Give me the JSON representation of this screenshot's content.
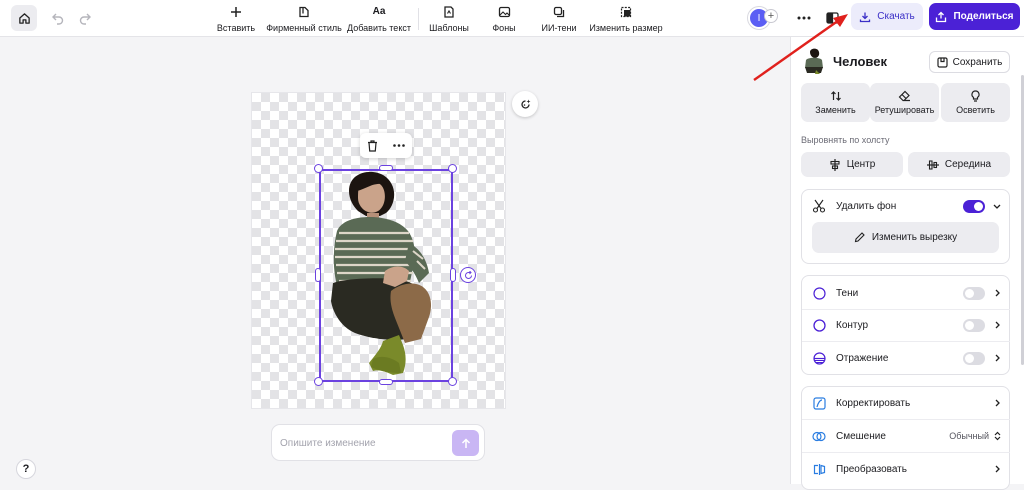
{
  "toolbar": {
    "insert": "Вставить",
    "brand_style": "Фирменный стиль",
    "add_text": "Добавить текст",
    "add_text_icon": "Aa",
    "templates": "Шаблоны",
    "backgrounds": "Фоны",
    "ai_shadows": "ИИ-тени",
    "resize": "Изменить размер",
    "avatar_initial": "I",
    "add_collab": "+",
    "download": "Скачать",
    "share": "Поделиться"
  },
  "canvas": {
    "prompt_placeholder": "Опишите изменение",
    "help": "?"
  },
  "sidebar": {
    "title": "Человек",
    "save": "Сохранить",
    "actions": [
      "Заменить",
      "Ретушировать",
      "Осветить"
    ],
    "align_label": "Выровнять по холсту",
    "align_center": "Центр",
    "align_middle": "Середина",
    "remove_bg": "Удалить фон",
    "remove_bg_on": true,
    "edit_cutout": "Изменить вырезку",
    "shadows": "Тени",
    "outline": "Контур",
    "reflection": "Отражение",
    "adjust": "Корректировать",
    "blend": "Смешение",
    "blend_value": "Обычный",
    "transform": "Преобразовать"
  },
  "colors": {
    "accent": "#4b21d6",
    "selection": "#6b42e0",
    "annotation_arrow": "#e0211d"
  }
}
